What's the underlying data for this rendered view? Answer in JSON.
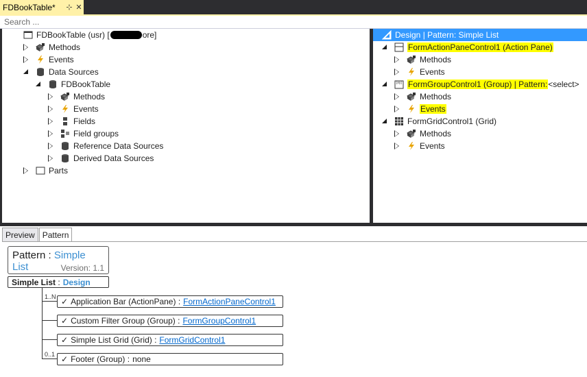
{
  "document_tab": {
    "title": "FDBookTable*",
    "pin": "⊹",
    "close": "✕"
  },
  "search": {
    "placeholder": "Search ..."
  },
  "left_tree": [
    {
      "label": "FDBookTable (usr) [",
      "suffix": "ore]",
      "indent": 0,
      "state": "none",
      "icon": "form-icon"
    },
    {
      "label": "Methods",
      "indent": 1,
      "state": "collapsed",
      "icon": "methods-icon"
    },
    {
      "label": "Events",
      "indent": 1,
      "state": "collapsed",
      "icon": "events-icon"
    },
    {
      "label": "Data Sources",
      "indent": 1,
      "state": "expanded",
      "icon": "datasource-icon"
    },
    {
      "label": "FDBookTable",
      "indent": 2,
      "state": "expanded",
      "icon": "datasource-icon"
    },
    {
      "label": "Methods",
      "indent": 3,
      "state": "collapsed",
      "icon": "methods-icon"
    },
    {
      "label": "Events",
      "indent": 3,
      "state": "collapsed",
      "icon": "events-icon"
    },
    {
      "label": "Fields",
      "indent": 3,
      "state": "collapsed",
      "icon": "fields-icon"
    },
    {
      "label": "Field groups",
      "indent": 3,
      "state": "collapsed",
      "icon": "field-groups-icon"
    },
    {
      "label": "Reference Data Sources",
      "indent": 3,
      "state": "collapsed",
      "icon": "datasource-icon"
    },
    {
      "label": "Derived Data Sources",
      "indent": 3,
      "state": "collapsed",
      "icon": "datasource-icon"
    },
    {
      "label": "Parts",
      "indent": 1,
      "state": "collapsed",
      "icon": "parts-icon"
    }
  ],
  "right_header": {
    "label": "Design | Pattern: Simple List"
  },
  "right_tree": [
    {
      "label": "FormActionPaneControl1 (Action Pane)",
      "indent": 1,
      "state": "expanded",
      "icon": "action-pane-icon",
      "highlight": true
    },
    {
      "label": "Methods",
      "indent": 2,
      "state": "collapsed",
      "icon": "methods-icon"
    },
    {
      "label": "Events",
      "indent": 2,
      "state": "collapsed",
      "icon": "events-icon"
    },
    {
      "label": "FormGroupControl1 (Group) | Pattern:",
      "suffix": " <select>",
      "indent": 1,
      "state": "expanded",
      "icon": "group-icon",
      "highlight": true
    },
    {
      "label": "Methods",
      "indent": 2,
      "state": "collapsed",
      "icon": "methods-icon"
    },
    {
      "label": "Events",
      "indent": 2,
      "state": "collapsed",
      "icon": "events-icon",
      "highlight": true
    },
    {
      "label": "FormGridControl1 (Grid)",
      "indent": 1,
      "state": "expanded",
      "icon": "grid-icon"
    },
    {
      "label": "Methods",
      "indent": 2,
      "state": "collapsed",
      "icon": "methods-icon"
    },
    {
      "label": "Events",
      "indent": 2,
      "state": "collapsed",
      "icon": "events-icon"
    }
  ],
  "bottom_tabs": [
    {
      "label": "Preview",
      "active": false
    },
    {
      "label": "Pattern",
      "active": true
    }
  ],
  "pattern_info": {
    "prefix": "Pattern :",
    "name": "Simple List",
    "version": "Version:  1.1"
  },
  "simple_list_node": {
    "label": "Simple List",
    "sep": ":",
    "design": "Design"
  },
  "pattern_items": [
    {
      "check": "✓",
      "text": "Application Bar (ActionPane) :",
      "link": "FormActionPaneControl1",
      "value": "",
      "mult": "1..N"
    },
    {
      "check": "✓",
      "text": "Custom Filter Group  (Group) :",
      "link": "FormGroupControl1",
      "value": "",
      "mult": ""
    },
    {
      "check": "✓",
      "text": "Simple List Grid  (Grid) :",
      "link": "FormGridControl1",
      "value": "",
      "mult": ""
    },
    {
      "check": "✓",
      "text": "Footer  (Group) :",
      "link": "",
      "value": "none",
      "mult": "0..1"
    }
  ],
  "colors": {
    "accent": "#3399ff",
    "highlight": "#ffff00",
    "tab_yellow": "#fff1a8",
    "frame": "#2d2d30",
    "link": "#0066cc"
  }
}
